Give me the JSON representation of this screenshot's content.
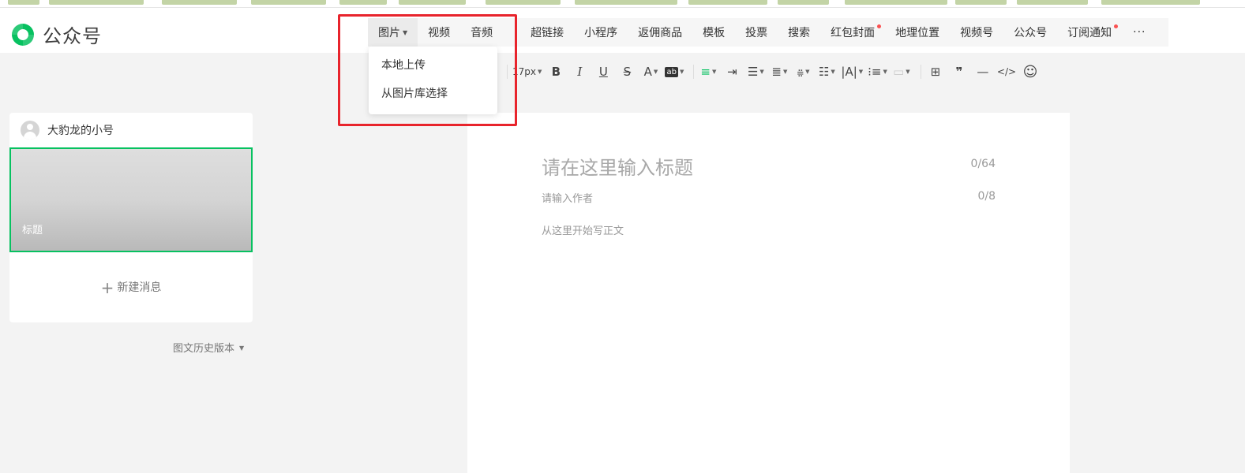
{
  "app": {
    "title": "公众号",
    "brand_color": "#07c160"
  },
  "insert_bar": {
    "items": [
      {
        "label": "图片",
        "icon": "chevron-down-icon",
        "active": true
      },
      {
        "label": "视频"
      },
      {
        "label": "音频"
      },
      {
        "label": "超链接"
      },
      {
        "label": "小程序"
      },
      {
        "label": "返佣商品"
      },
      {
        "label": "模板"
      },
      {
        "label": "投票"
      },
      {
        "label": "搜索"
      },
      {
        "label": "红包封面",
        "badge": true
      },
      {
        "label": "地理位置"
      },
      {
        "label": "视频号"
      },
      {
        "label": "公众号"
      },
      {
        "label": "订阅通知",
        "badge": true
      }
    ],
    "more": "···"
  },
  "image_dropdown": {
    "items": [
      "本地上传",
      "从图片库选择"
    ]
  },
  "format_toolbar": {
    "font_size": "17px",
    "icons": [
      "bold-icon",
      "italic-icon",
      "underline-icon",
      "strikethrough-icon",
      "font-color-icon",
      "highlight-icon",
      "align-justify-icon",
      "indent-icon",
      "align-icon",
      "line-height-icon",
      "paragraph-spacing-icon",
      "first-line-indent-icon",
      "letter-spacing-icon",
      "list-icon",
      "clear-format-icon",
      "table-icon",
      "quote-icon",
      "divider-icon",
      "code-icon",
      "emoji-icon"
    ]
  },
  "sidebar": {
    "account_name": "大豹龙的小号",
    "cover_title": "标题",
    "new_message": "新建消息",
    "history": "图文历史版本"
  },
  "editor": {
    "title_placeholder": "请在这里输入标题",
    "title_count": "0/64",
    "author_placeholder": "请输入作者",
    "author_count": "0/8",
    "body_placeholder": "从这里开始写正文"
  }
}
